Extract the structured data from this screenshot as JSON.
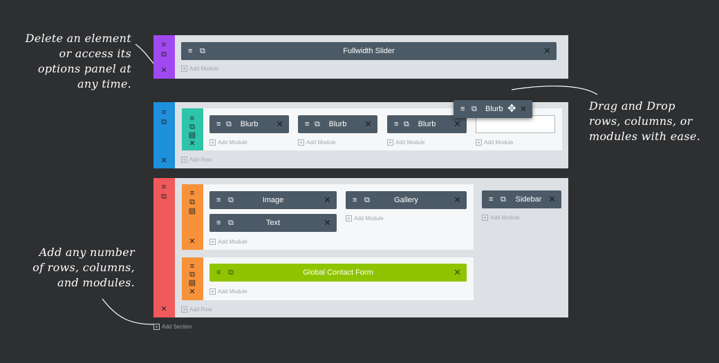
{
  "annotations": {
    "top_left": [
      "Delete an element",
      "or access its",
      "options panel at",
      "any time."
    ],
    "right": [
      "Drag and Drop",
      "rows, columns, or",
      "modules with ease."
    ],
    "bottom_left": [
      "Add any number",
      "of rows, columns,",
      "and modules."
    ]
  },
  "colors": {
    "background": "#2e2f31",
    "section_1": "#a149f0",
    "section_2": "#1e90dc",
    "section_3": "#f05a5a",
    "row_teal": "#2ec4a9",
    "row_orange": "#f7923a",
    "module": "#4b5a66",
    "global_module": "#8fc400"
  },
  "icons": {
    "menu": "≡",
    "copy": "⧉",
    "columns": "▤",
    "close": "✕",
    "move": "✥",
    "plus": "+"
  },
  "labels": {
    "add_module": "Add Module",
    "add_row": "Add Row",
    "add_section": "Add Section"
  },
  "sections": {
    "s1": {
      "module": "Fullwidth Slider"
    },
    "s2": {
      "modules": [
        "Blurb",
        "Blurb",
        "Blurb"
      ],
      "dragging": "Blurb"
    },
    "s3": {
      "row1": {
        "col1": [
          "Image",
          "Text"
        ],
        "col2": [
          "Gallery"
        ],
        "col3": [
          "Sidebar"
        ]
      },
      "row2": {
        "module": "Global Contact Form"
      }
    }
  }
}
